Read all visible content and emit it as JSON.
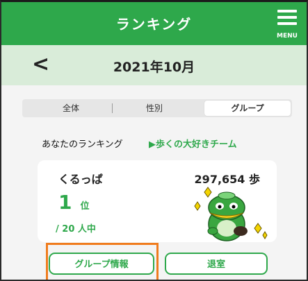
{
  "header": {
    "title": "ランキング",
    "menu_label": "MENU"
  },
  "date_bar": {
    "back_icon": "chevron-left-icon",
    "month": "2021年10月"
  },
  "tabs": [
    {
      "label": "全体",
      "active": false
    },
    {
      "label": "性別",
      "active": false
    },
    {
      "label": "グループ",
      "active": true
    }
  ],
  "ranking": {
    "heading": "あなたのランキング",
    "team_name": "▶歩くの大好きチーム",
    "name": "くるっぱ",
    "steps": "297,654 歩",
    "rank_number": "1",
    "rank_unit": "位",
    "total": "/ 20 人中"
  },
  "buttons": {
    "group_info": "グループ情報",
    "leave": "退室"
  },
  "colors": {
    "brand_green": "#2ea84b",
    "date_bar_bg": "#d9ecd9",
    "highlight_orange": "#f07c1e"
  }
}
